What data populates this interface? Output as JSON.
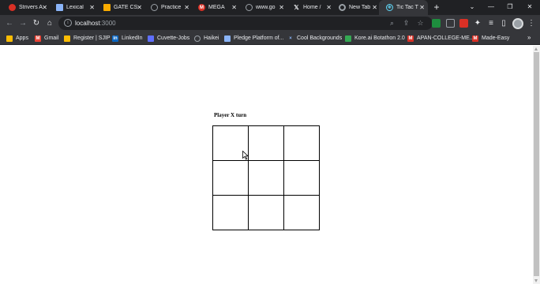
{
  "browser": {
    "tabs": [
      {
        "label": "Strivers A",
        "icon": "striver-icon",
        "color": "#d93025",
        "active": false
      },
      {
        "label": "Lexical",
        "icon": "doc-icon",
        "color": "#8ab4f8",
        "active": false
      },
      {
        "label": "GATE CS",
        "icon": "gfg-icon",
        "color": "#f9ab00",
        "active": false
      },
      {
        "label": "Practice",
        "icon": "globe-icon",
        "color": "#9aa0a6",
        "active": false
      },
      {
        "label": "MEGA",
        "icon": "mega-icon",
        "color": "#d93025",
        "active": false
      },
      {
        "label": "www.go",
        "icon": "globe-icon",
        "color": "#9aa0a6",
        "active": false
      },
      {
        "label": "Home / ",
        "icon": "x-icon",
        "color": "#e8eaed",
        "active": false
      },
      {
        "label": "New Tab",
        "icon": "chrome-icon",
        "color": "#9aa0a6",
        "active": false
      },
      {
        "label": "Tic Tac T",
        "icon": "react-icon",
        "color": "#61dafb",
        "active": true
      }
    ],
    "new_tab_symbol": "+",
    "url": {
      "host": "localhost",
      "port": ":3000"
    },
    "bookmarks": [
      {
        "label": "Apps",
        "icon": "apps-grid-icon",
        "color": "#fbbc04"
      },
      {
        "label": "Gmail",
        "icon": "gmail-icon",
        "color": "#ea4335"
      },
      {
        "label": "Register | SJIP",
        "icon": "sjip-icon",
        "color": "#fbbc04"
      },
      {
        "label": "LinkedIn",
        "icon": "linkedin-icon",
        "color": "#0a66c2"
      },
      {
        "label": "Cuvette-Jobs",
        "icon": "cuvette-icon",
        "color": "#5f6fff"
      },
      {
        "label": "Haikei",
        "icon": "globe-icon",
        "color": "#9aa0a6"
      },
      {
        "label": "Pledge Platform of...",
        "icon": "pledge-icon",
        "color": "#8ab4f8"
      },
      {
        "label": "Cool Backgrounds",
        "icon": "cross-icon",
        "color": "#8ab4f8"
      },
      {
        "label": "Kore.ai Botathon 2.0",
        "icon": "chart-icon",
        "color": "#34a853"
      },
      {
        "label": "APAN-COLLEGE-ME...",
        "icon": "mega-icon",
        "color": "#d93025"
      },
      {
        "label": "Made-Easy",
        "icon": "mega-icon",
        "color": "#d93025"
      }
    ]
  },
  "game": {
    "status": "Player X turn",
    "cells": [
      "",
      "",
      "",
      "",
      "",
      "",
      "",
      "",
      ""
    ]
  }
}
